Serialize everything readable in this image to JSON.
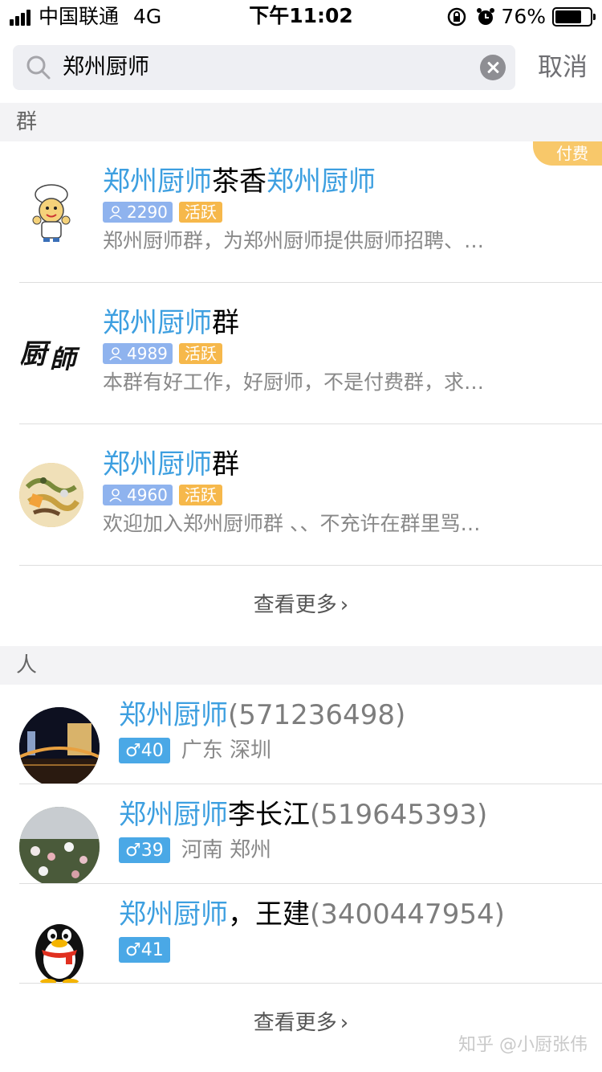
{
  "status_bar": {
    "carrier": "中国联通",
    "network": "4G",
    "time": "下午11:02",
    "battery_percent": "76%",
    "battery_level": 0.76
  },
  "search": {
    "query": "郑州厨师",
    "cancel_label": "取消"
  },
  "groups_section": {
    "header": "群",
    "items": [
      {
        "title_parts": [
          "郑州厨师",
          "茶香",
          "郑州厨师"
        ],
        "member_count": "2290",
        "active_tag": "活跃",
        "description": "郑州厨师群，为郑州厨师提供厨师招聘、…",
        "badge": "付费"
      },
      {
        "title_parts": [
          "郑州厨师",
          "群"
        ],
        "member_count": "4989",
        "active_tag": "活跃",
        "description": "本群有好工作，好厨师，不是付费群，求…"
      },
      {
        "title_parts": [
          "郑州厨师",
          "群"
        ],
        "member_count": "4960",
        "active_tag": "活跃",
        "description": "欢迎加入郑州厨师群 、、不充许在群里骂…"
      }
    ],
    "more_label": "查看更多"
  },
  "people_section": {
    "header": "人",
    "items": [
      {
        "name_hl": "郑州厨师",
        "name_rest": "",
        "qq": "(571236498)",
        "gender_age": "♂40",
        "location": "广东 深圳"
      },
      {
        "name_hl": "郑州厨师",
        "name_rest": "李长江",
        "qq": "(519645393)",
        "gender_age": "♂39",
        "location": "河南 郑州"
      },
      {
        "name_hl": "郑州厨师",
        "name_rest": "，王建",
        "qq": "(3400447954)",
        "gender_age": "♂41",
        "location": ""
      }
    ],
    "more_label": "查看更多"
  },
  "watermark": "知乎 @小厨张伟",
  "colors": {
    "highlight": "#3d9fe0",
    "member_tag": "#8fb3ee",
    "active_tag": "#f6b84b",
    "gender_tag": "#4aa8e6",
    "paid_badge": "#f8c86a"
  },
  "icons": {
    "avatar_1": "chef-cartoon-icon",
    "avatar_2": "calligraphy-chef-icon",
    "avatar_3": "food-dish-photo",
    "person_avatar_1": "night-bridge-photo",
    "person_avatar_2": "flowers-photo",
    "person_avatar_3": "qq-penguin-icon"
  }
}
